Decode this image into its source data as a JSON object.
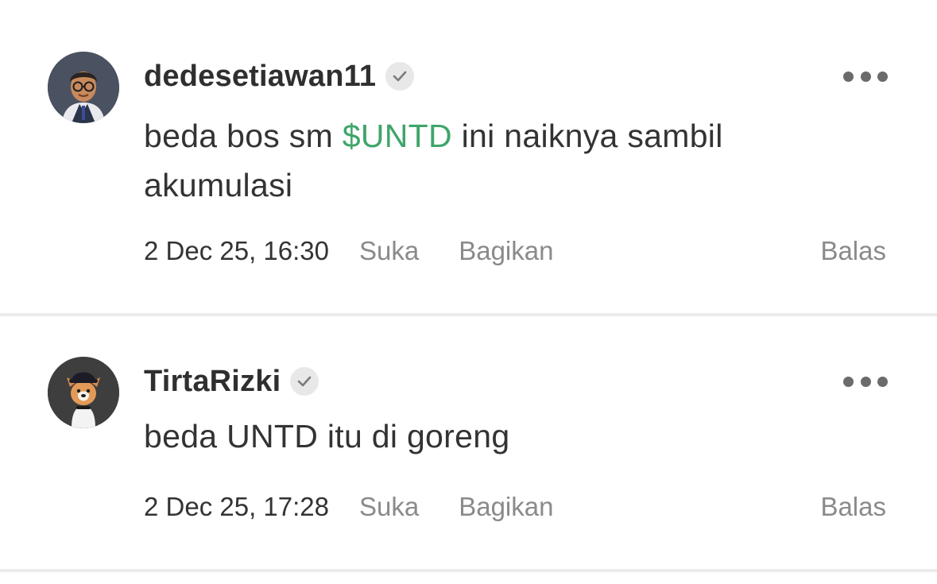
{
  "comments": [
    {
      "username": "dedesetiawan11",
      "verified": true,
      "avatar": "3d-man-with-glasses-avatar",
      "text_before": "beda bos sm ",
      "ticker": "$UNTD",
      "text_after": " ini naiknya sambil akumulasi",
      "timestamp": "2 Dec 25, 16:30",
      "like_label": "Suka",
      "share_label": "Bagikan",
      "reply_label": "Balas"
    },
    {
      "username": "TirtaRizki",
      "verified": true,
      "avatar": "dog-with-hat-avatar",
      "text": "beda UNTD itu di goreng",
      "timestamp": "2 Dec 25, 17:28",
      "like_label": "Suka",
      "share_label": "Bagikan",
      "reply_label": "Balas"
    }
  ],
  "colors": {
    "ticker": "#3fa56a",
    "action_text": "#8a8a8a",
    "divider": "#ececec"
  },
  "icons": {
    "verified": "checkmark-badge-icon",
    "more": "more-horizontal-icon"
  }
}
